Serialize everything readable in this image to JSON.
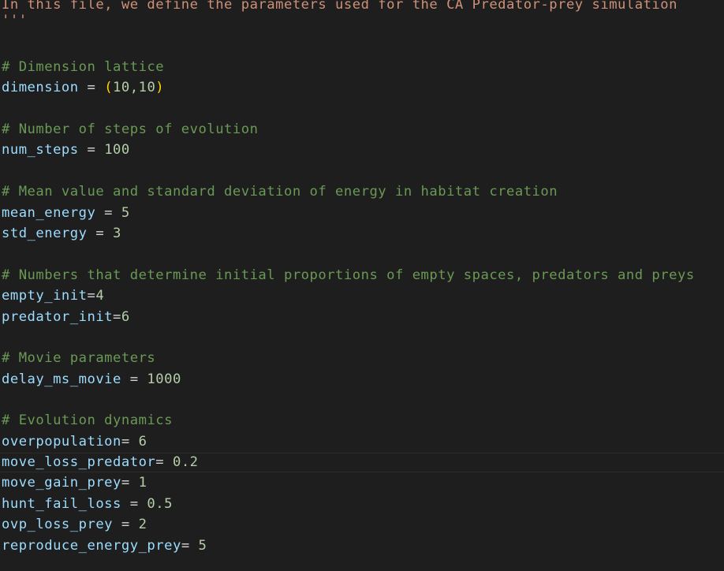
{
  "editor": {
    "colors": {
      "background": "#1e1e1e",
      "string": "#ce9178",
      "comment": "#6a9955",
      "variable": "#9cdcfe",
      "operator": "#d4d4d4",
      "number": "#b5cea8",
      "bracket": "#ffd700"
    },
    "docstring": {
      "text": "In this file, we define the parameters used for the CA Predator-prey simulation",
      "close": "'''"
    },
    "c1": "# Dimension lattice",
    "dim": {
      "name": "dimension",
      "op": " = ",
      "open": "(",
      "value": "10,10",
      "close": ")"
    },
    "c2": "# Number of steps of evolution",
    "steps": {
      "name": "num_steps",
      "op": " = ",
      "value": "100"
    },
    "c3": "# Mean value and standard deviation of energy in habitat creation",
    "mean": {
      "name": "mean_energy",
      "op": " = ",
      "value": "5"
    },
    "std": {
      "name": "std_energy",
      "op": " = ",
      "value": "3"
    },
    "c4": "# Numbers that determine initial proportions of empty spaces, predators and preys",
    "empty": {
      "name": "empty_init",
      "op": "=",
      "value": "4"
    },
    "pred": {
      "name": "predator_init",
      "op": "=",
      "value": "6"
    },
    "c5": "# Movie parameters",
    "delay": {
      "name": "delay_ms_movie",
      "op": " = ",
      "value": "1000"
    },
    "c6": "# Evolution dynamics",
    "overpop": {
      "name": "overpopulation",
      "op": "= ",
      "value": "6"
    },
    "mlp": {
      "name": "move_loss_predator",
      "op": "= ",
      "value": "0.2"
    },
    "mgp": {
      "name": "move_gain_prey",
      "op": "= ",
      "value": "1"
    },
    "hfl": {
      "name": "hunt_fail_loss",
      "op": " = ",
      "value": "0.5"
    },
    "olp": {
      "name": "ovp_loss_prey",
      "op": " = ",
      "value": "2"
    },
    "rep": {
      "name": "reproduce_energy_prey",
      "op": "= ",
      "value": "5"
    }
  }
}
